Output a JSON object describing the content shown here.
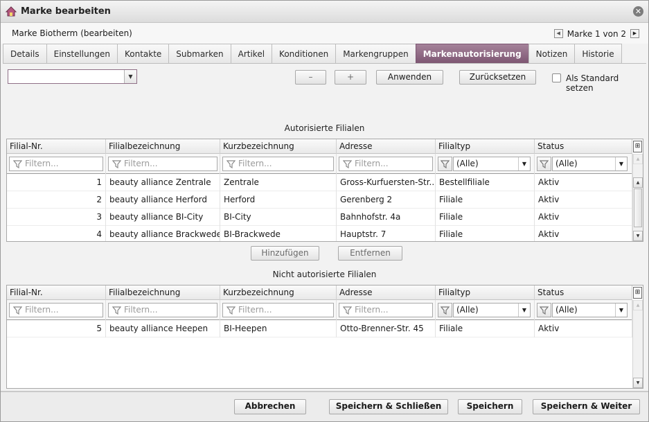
{
  "window": {
    "title": "Marke bearbeiten",
    "subtitle": "Marke Biotherm (bearbeiten)",
    "pager": "Marke 1 von 2"
  },
  "tabs": [
    {
      "label": "Details",
      "active": false
    },
    {
      "label": "Einstellungen",
      "active": false
    },
    {
      "label": "Kontakte",
      "active": false
    },
    {
      "label": "Submarken",
      "active": false
    },
    {
      "label": "Artikel",
      "active": false
    },
    {
      "label": "Konditionen",
      "active": false
    },
    {
      "label": "Markengruppen",
      "active": false
    },
    {
      "label": "Markenautorisierung",
      "active": true
    },
    {
      "label": "Notizen",
      "active": false
    },
    {
      "label": "Historie",
      "active": false
    }
  ],
  "toolbar": {
    "combo_value": "",
    "minus_label": "–",
    "plus_label": "+",
    "apply_label": "Anwenden",
    "reset_label": "Zurücksetzen",
    "default_label": "Als Standard setzen",
    "default_checked": false
  },
  "authorized": {
    "caption": "Autorisierte Filialen",
    "columns": [
      "Filial-Nr.",
      "Filialbezeichnung",
      "Kurzbezeichnung",
      "Adresse",
      "Filialtyp",
      "Status"
    ],
    "filter_placeholder": "Filtern...",
    "filter_select": "(Alle)",
    "rows": [
      [
        "1",
        "beauty alliance Zentrale",
        "Zentrale",
        "Gross-Kurfuersten-Str...",
        "Bestellfiliale",
        "Aktiv"
      ],
      [
        "2",
        "beauty alliance Herford",
        "Herford",
        "Gerenberg 2",
        "Filiale",
        "Aktiv"
      ],
      [
        "3",
        "beauty alliance BI-City",
        "BI-City",
        "Bahnhofstr. 4a",
        "Filiale",
        "Aktiv"
      ],
      [
        "4",
        "beauty alliance Brackwede",
        "BI-Brackwede",
        "Hauptstr. 7",
        "Filiale",
        "Aktiv"
      ]
    ]
  },
  "middle_buttons": {
    "add_label": "Hinzufügen",
    "remove_label": "Entfernen"
  },
  "unauthorized": {
    "caption": "Nicht autorisierte Filialen",
    "columns": [
      "Filial-Nr.",
      "Filialbezeichnung",
      "Kurzbezeichnung",
      "Adresse",
      "Filialtyp",
      "Status"
    ],
    "filter_placeholder": "Filtern...",
    "filter_select": "(Alle)",
    "rows": [
      [
        "5",
        "beauty alliance Heepen",
        "BI-Heepen",
        "Otto-Brenner-Str. 45",
        "Filiale",
        "Aktiv"
      ]
    ]
  },
  "footer": {
    "cancel_label": "Abbrechen",
    "save_close_label": "Speichern & Schließen",
    "save_label": "Speichern",
    "save_next_label": "Speichern & Weiter"
  },
  "colors": {
    "accent": "#8a6381",
    "window_bg": "#f2f2f2"
  }
}
